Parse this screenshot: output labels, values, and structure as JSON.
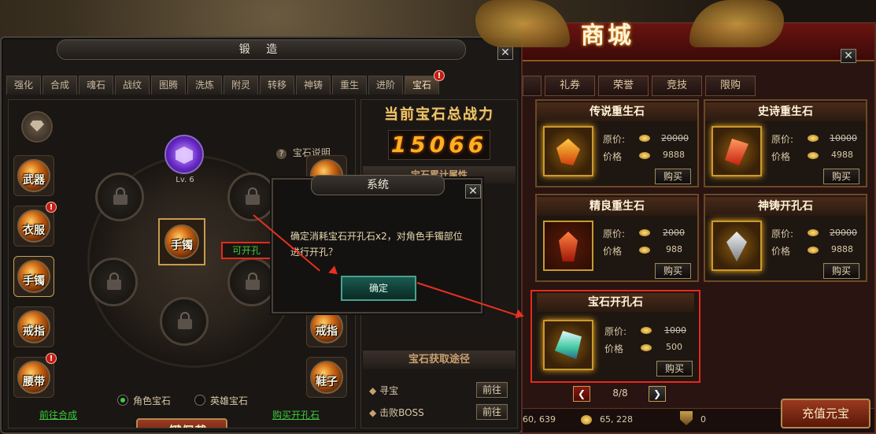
{
  "forge": {
    "title": "锻 造",
    "tabs": [
      "强化",
      "合成",
      "魂石",
      "战纹",
      "图腾",
      "洗炼",
      "附灵",
      "转移",
      "神铸",
      "重生",
      "进阶",
      "宝石"
    ],
    "gem_help": "宝石说明",
    "center_gem_level": "Lv. 6",
    "center_slot_label": "手镯",
    "can_open_hole": "可开孔",
    "left_slots": [
      "武器",
      "衣服",
      "手镯",
      "戒指",
      "腰带"
    ],
    "right_slots": [
      "戒指",
      "鞋子"
    ],
    "radio_role": "角色宝石",
    "radio_hero": "英雄宝石",
    "equip_all": "一键佩戴",
    "goto_synth": "前往合成",
    "buy_hole_stone": "购买开孔石",
    "power_title": "当前宝石总战力",
    "power_value": "15066",
    "attr_title": "宝石累计属性",
    "source_title": "宝石获取途径",
    "sources": [
      {
        "label": "寻宝",
        "button": "前往"
      },
      {
        "label": "击败BOSS",
        "button": "前往"
      }
    ]
  },
  "dialog": {
    "title": "系统",
    "message": "确定消耗宝石开孔石x2，对角色手镯部位进行开孔？",
    "confirm": "确定"
  },
  "shop": {
    "title": "商城",
    "tabs": [
      "礼券",
      "荣誉",
      "竞技",
      "限购"
    ],
    "items": [
      {
        "name": "传说重生石",
        "orig_label": "原价:",
        "orig": "20000",
        "price_label": "价格",
        "price": "9888",
        "buy": "购买"
      },
      {
        "name": "史诗重生石",
        "orig_label": "原价:",
        "orig": "10000",
        "price_label": "价格",
        "price": "4988",
        "buy": "购买"
      },
      {
        "name": "精良重生石",
        "orig_label": "原价:",
        "orig": "2000",
        "price_label": "价格",
        "price": "988",
        "buy": "购买"
      },
      {
        "name": "神铸开孔石",
        "orig_label": "原价:",
        "orig": "20000",
        "price_label": "价格",
        "price": "9888",
        "buy": "购买"
      },
      {
        "name": "宝石开孔石",
        "orig_label": "原价:",
        "orig": "1000",
        "price_label": "价格",
        "price": "500",
        "buy": "购买"
      }
    ],
    "page": "8/8",
    "balance_1": "60, 639",
    "balance_2": "65, 228",
    "balance_3": "0",
    "recharge": "充值元宝"
  },
  "colors": {
    "highlight": "#e8281c",
    "link_green": "#3cc83c",
    "power_gold": "#ffb020"
  }
}
